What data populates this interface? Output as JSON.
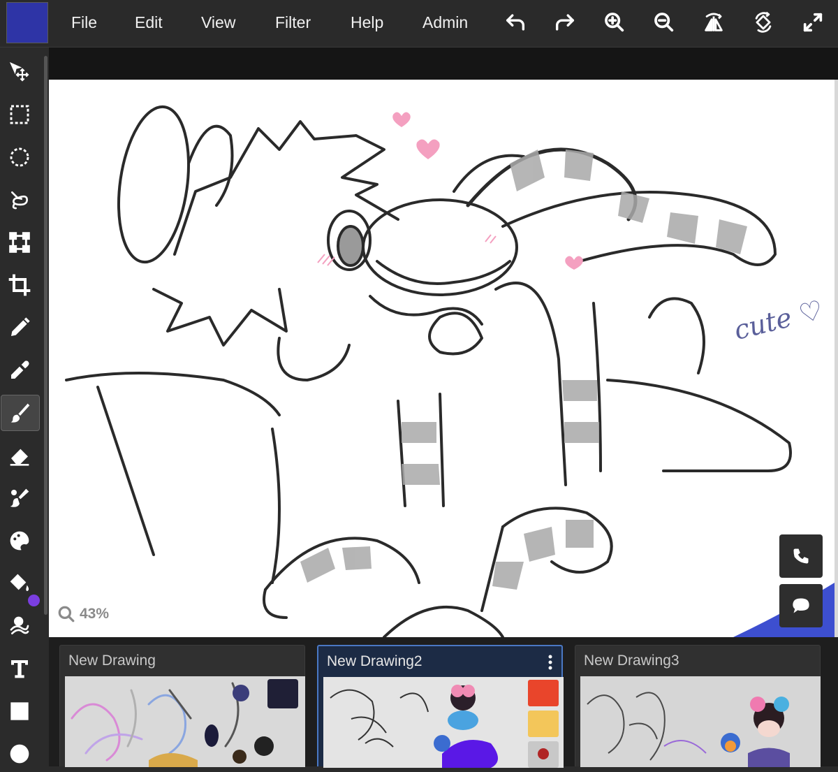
{
  "colors": {
    "primary_swatch": "#2e34a6",
    "secondary_color": "#7a3ee0",
    "accent": "#4a78c4"
  },
  "menu": {
    "items": [
      "File",
      "Edit",
      "View",
      "Filter",
      "Help",
      "Admin"
    ]
  },
  "toolbar_buttons": [
    "undo-icon",
    "redo-icon",
    "zoom-in-icon",
    "zoom-out-icon",
    "flip-icon",
    "rotate-icon",
    "fullscreen-icon"
  ],
  "tools": [
    "move-icon",
    "rect-select-icon",
    "ellipse-select-icon",
    "lasso-icon",
    "transform-icon",
    "crop-icon",
    "pencil-icon",
    "eyedropper-icon",
    "brush-icon",
    "eraser-icon",
    "smudge-icon",
    "color-picker-icon",
    "fill-icon",
    "blend-icon",
    "text-icon",
    "rectangle-icon",
    "circle-icon"
  ],
  "active_tool": "brush-icon",
  "canvas": {
    "zoom_label": "43%",
    "annotation": "cute ♡"
  },
  "float_buttons": [
    "phone-icon",
    "chat-icon"
  ],
  "tabs": [
    {
      "title": "New Drawing",
      "active": false
    },
    {
      "title": "New Drawing2",
      "active": true
    },
    {
      "title": "New Drawing3",
      "active": false
    }
  ]
}
